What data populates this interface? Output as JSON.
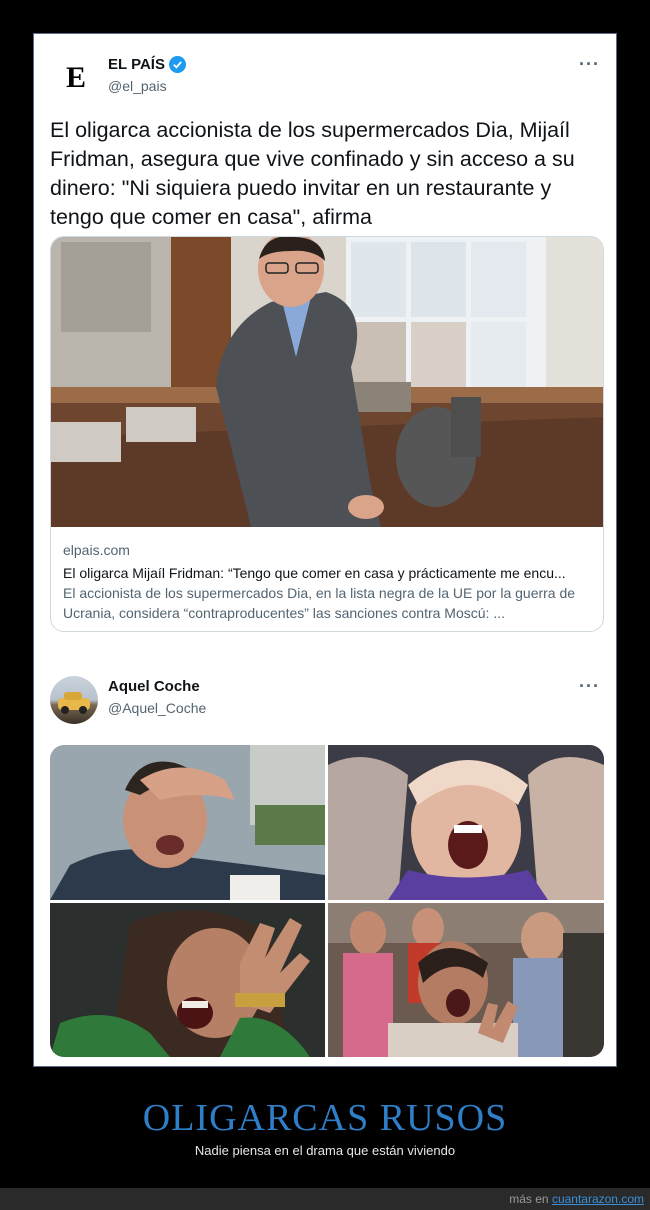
{
  "tweet1": {
    "avatar_letter": "E",
    "display_name": "EL PAÍS",
    "handle": "@el_pais",
    "more": "···",
    "text": "El oligarca accionista de los supermercados Dia, Mijaíl Fridman, asegura que vive confinado y sin acceso a su dinero: \"Ni siquiera puedo invitar en un restaurante y tengo que comer en casa\", afirma",
    "card": {
      "domain": "elpais.com",
      "title": "El oligarca Mijaíl Fridman: “Tengo que comer en casa y prácticamente me encu...",
      "description": "El accionista de los supermercados Dia, en la lista negra de la UE por la guerra de Ucrania, considera “contraproducentes” las sanciones contra Moscú: ..."
    }
  },
  "tweet2": {
    "display_name": "Aquel Coche",
    "handle": "@Aquel_Coche",
    "more": "···"
  },
  "caption": {
    "title": "OLIGARCAS RUSOS",
    "subtitle": "Nadie piensa en el drama que están viviendo"
  },
  "footer": {
    "prefix": "más en ",
    "link": "cuantarazon.com"
  },
  "colors": {
    "verified": "#1d9bf0",
    "caption_title": "#2f7fc8",
    "link": "#3a8fd9"
  }
}
